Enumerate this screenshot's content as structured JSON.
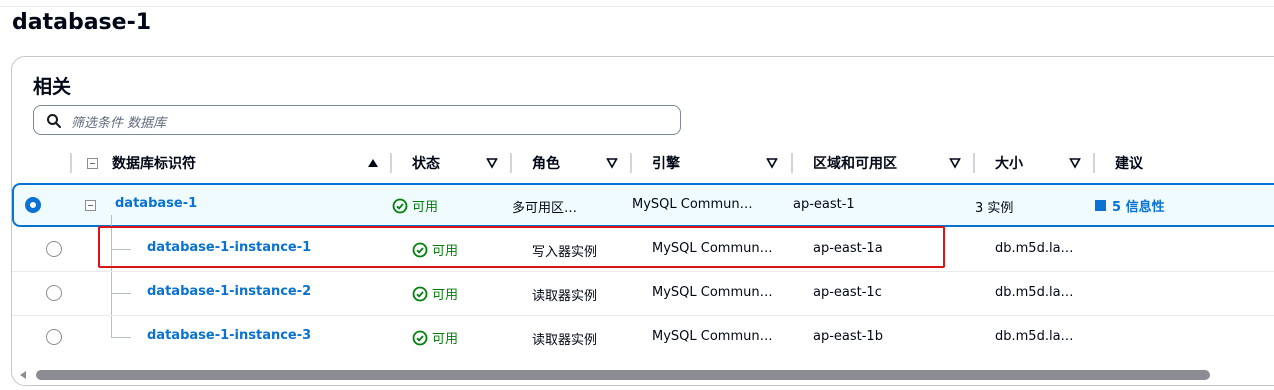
{
  "page": {
    "title": "database-1"
  },
  "panel": {
    "title": "相关",
    "search": {
      "placeholder": "筛选条件 数据库",
      "icon": "search-icon"
    }
  },
  "columns": [
    {
      "key": "id",
      "label": "数据库标识符",
      "sort": "ascending"
    },
    {
      "key": "status",
      "label": "状态",
      "sort": "none"
    },
    {
      "key": "role",
      "label": "角色",
      "sort": "none"
    },
    {
      "key": "engine",
      "label": "引擎",
      "sort": "none"
    },
    {
      "key": "region",
      "label": "区域和可用区",
      "sort": "none"
    },
    {
      "key": "size",
      "label": "大小",
      "sort": "none"
    },
    {
      "key": "rec",
      "label": "建议"
    }
  ],
  "rows": [
    {
      "id": "database-1",
      "status": "可用",
      "role": "多可用区…",
      "engine": "MySQL Commun…",
      "region": "ap-east-1",
      "size": "3 实例",
      "rec": "5 信息性",
      "selected": true
    },
    {
      "id": "database-1-instance-1",
      "status": "可用",
      "role": "写入器实例",
      "engine": "MySQL Commun…",
      "region": "ap-east-1a",
      "size": "db.m5d.la…",
      "rec": ""
    },
    {
      "id": "database-1-instance-2",
      "status": "可用",
      "role": "读取器实例",
      "engine": "MySQL Commun…",
      "region": "ap-east-1c",
      "size": "db.m5d.la…",
      "rec": ""
    },
    {
      "id": "database-1-instance-3",
      "status": "可用",
      "role": "读取器实例",
      "engine": "MySQL Commun…",
      "region": "ap-east-1b",
      "size": "db.m5d.la…",
      "rec": ""
    }
  ],
  "colors": {
    "accent": "#0972d3",
    "success": "#037f0c",
    "highlight": "#d91515"
  }
}
